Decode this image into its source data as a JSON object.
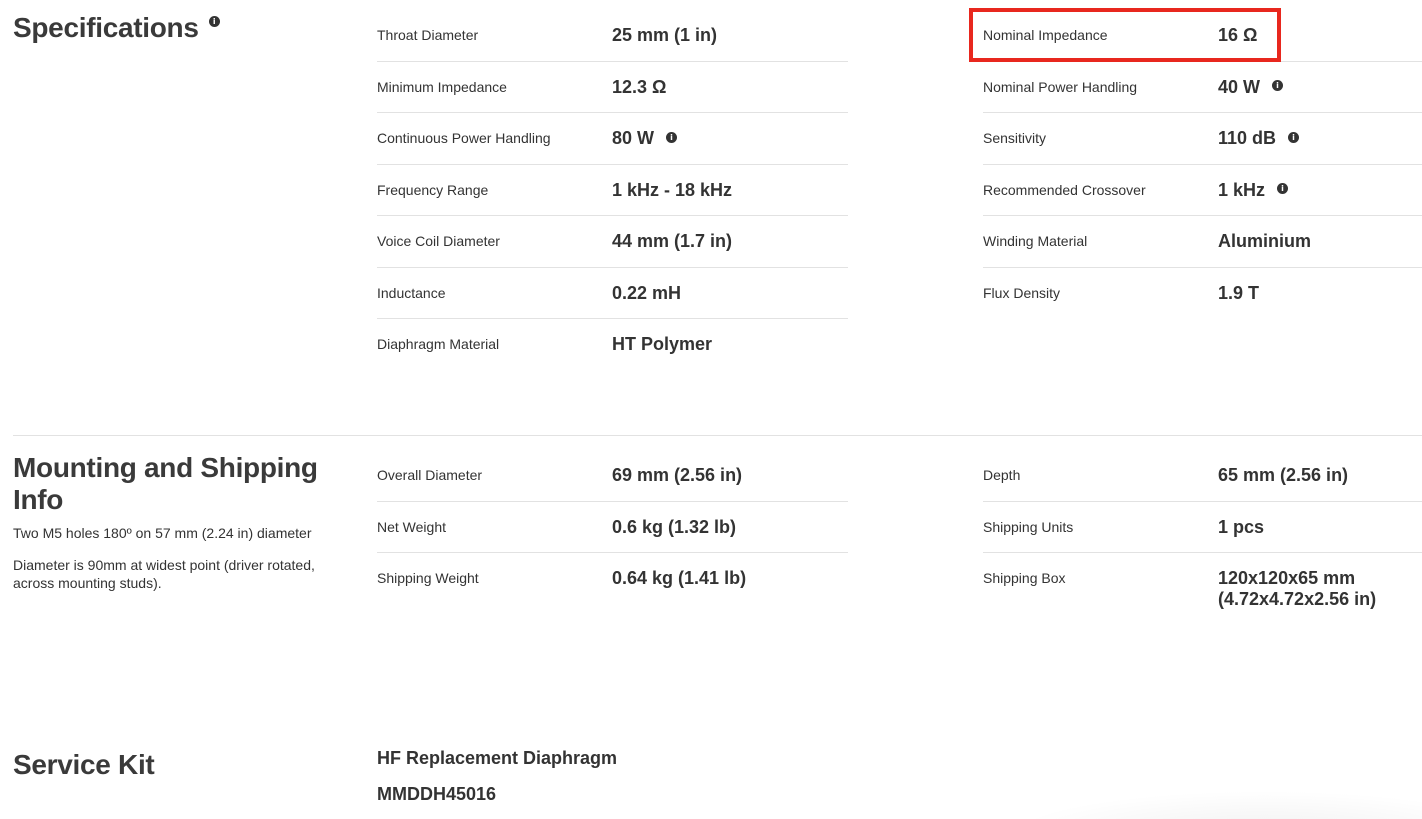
{
  "specifications": {
    "title": "Specifications",
    "left": [
      {
        "label": "Throat Diameter",
        "value": "25 mm (1 in)",
        "info": false
      },
      {
        "label": "Minimum Impedance",
        "value": "12.3 Ω",
        "info": false
      },
      {
        "label": "Continuous Power Handling",
        "value": "80 W",
        "info": true
      },
      {
        "label": "Frequency Range",
        "value": "1 kHz - 18 kHz",
        "info": false
      },
      {
        "label": "Voice Coil Diameter",
        "value": "44 mm (1.7 in)",
        "info": false
      },
      {
        "label": "Inductance",
        "value": "0.22 mH",
        "info": false
      },
      {
        "label": "Diaphragm Material",
        "value": "HT Polymer",
        "info": false
      }
    ],
    "right": [
      {
        "label": "Nominal Impedance",
        "value": "16 Ω",
        "info": false
      },
      {
        "label": "Nominal Power Handling",
        "value": "40 W",
        "info": true
      },
      {
        "label": "Sensitivity",
        "value": "110 dB",
        "info": true
      },
      {
        "label": "Recommended Crossover",
        "value": "1 kHz",
        "info": true
      },
      {
        "label": "Winding Material",
        "value": "Aluminium",
        "info": false
      },
      {
        "label": "Flux Density",
        "value": "1.9 T",
        "info": false
      }
    ]
  },
  "mounting": {
    "title_line1": "Mounting and Shipping",
    "title_line2": "Info",
    "note1": "Two M5 holes 180º on 57 mm (2.24 in) diameter",
    "note2": "Diameter is 90mm at widest point (driver rotated, across mounting studs).",
    "left": [
      {
        "label": "Overall Diameter",
        "value": "69 mm (2.56 in)"
      },
      {
        "label": "Net Weight",
        "value": "0.6 kg (1.32 lb)"
      },
      {
        "label": "Shipping Weight",
        "value": "0.64 kg (1.41 lb)"
      }
    ],
    "right": [
      {
        "label": "Depth",
        "value": "65 mm (2.56 in)"
      },
      {
        "label": "Shipping Units",
        "value": "1 pcs"
      },
      {
        "label": "Shipping Box",
        "value_line1": "120x120x65 mm",
        "value_line2": "(4.72x4.72x2.56 in)"
      }
    ]
  },
  "service": {
    "title": "Service Kit",
    "item_name": "HF Replacement Diaphragm",
    "item_code": "MMDDH45016"
  },
  "icons": {
    "info": "info-icon",
    "info_glyph": "i"
  },
  "colors": {
    "highlight": "#e8271e"
  }
}
